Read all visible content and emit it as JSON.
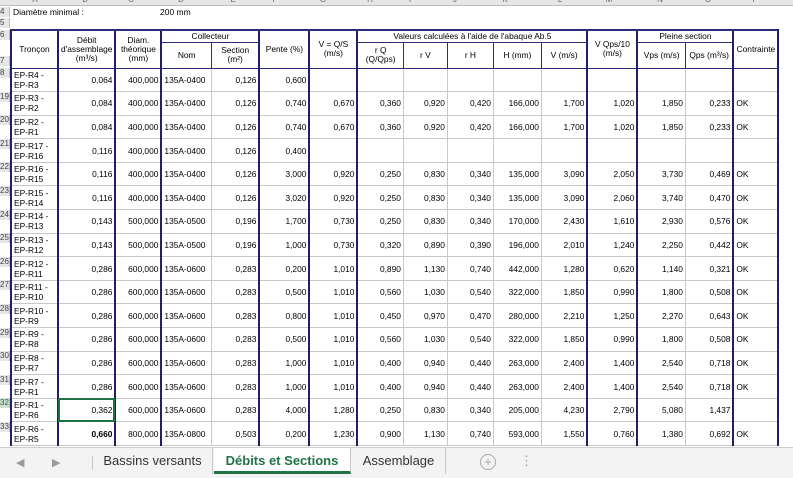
{
  "colhdr": [
    "A",
    "B",
    "C",
    "D",
    "E",
    "F",
    "G",
    "H",
    "I",
    "J",
    "K",
    "L",
    "M",
    "N",
    "O",
    "P"
  ],
  "top_rows": {
    "r4_label": "Diamètre minimal :",
    "r4_value": "200 mm",
    "rownums": [
      "4",
      "5",
      "6",
      "7"
    ]
  },
  "header": {
    "troncon": "Tronçon",
    "debit": "Débit d'assemblage (m³/s)",
    "diam": "Diam. théorique (mm)",
    "collecteur": "Collecteur",
    "nom": "Nom",
    "section": "Section (m²)",
    "pente": "Pente (%)",
    "vqs": "V = Q/S (m/s)",
    "valeurs": "Valeurs calculées à l'aide de l'abaque Ab.5",
    "rq": "r Q (Q/Qps)",
    "rv": "r V",
    "rh": "r H",
    "hmm": "H (mm)",
    "vms": "V (m/s)",
    "vqps": "V Qps/10 (m/s)",
    "pleine": "Pleine section",
    "vps": "Vps (m/s)",
    "qps": "Qps (m³/s)",
    "contrainte": "Contrainte"
  },
  "rows": [
    {
      "rn": "8",
      "t1": "EP-R4 -",
      "t2": "EP-R3",
      "q": "0,064",
      "d": "400,000",
      "nom": "135A-0400",
      "s": "0,126",
      "p": "0,600",
      "v": "",
      "rq": "",
      "rv": "",
      "rh": "",
      "h": "",
      "vv": "",
      "vq": "",
      "vps": "",
      "qps": "",
      "c": ""
    },
    {
      "rn": "19",
      "t1": "EP-R3 -",
      "t2": "EP-R2",
      "q": "0,084",
      "d": "400,000",
      "nom": "135A-0400",
      "s": "0,126",
      "p": "0,740",
      "v": "0,670",
      "rq": "0,360",
      "rv": "0,920",
      "rh": "0,420",
      "h": "166,000",
      "vv": "1,700",
      "vq": "1,020",
      "vps": "1,850",
      "qps": "0,233",
      "c": "OK"
    },
    {
      "rn": "20",
      "t1": "EP-R2 -",
      "t2": "EP-R1",
      "q": "0,084",
      "d": "400,000",
      "nom": "135A-0400",
      "s": "0,126",
      "p": "0,740",
      "v": "0,670",
      "rq": "0,360",
      "rv": "0,920",
      "rh": "0,420",
      "h": "166,000",
      "vv": "1,700",
      "vq": "1,020",
      "vps": "1,850",
      "qps": "0,233",
      "c": "OK"
    },
    {
      "rn": "21",
      "t1": "EP-R17 -",
      "t2": "EP-R16",
      "q": "0,116",
      "d": "400,000",
      "nom": "135A-0400",
      "s": "0,126",
      "p": "0,400",
      "v": "",
      "rq": "",
      "rv": "",
      "rh": "",
      "h": "",
      "vv": "",
      "vq": "",
      "vps": "",
      "qps": "",
      "c": ""
    },
    {
      "rn": "22",
      "t1": "EP-R16 -",
      "t2": "EP-R15",
      "q": "0,116",
      "d": "400,000",
      "nom": "135A-0400",
      "s": "0,126",
      "p": "3,000",
      "v": "0,920",
      "rq": "0,250",
      "rv": "0,830",
      "rh": "0,340",
      "h": "135,000",
      "vv": "3,090",
      "vq": "2,050",
      "vps": "3,730",
      "qps": "0,469",
      "c": "OK"
    },
    {
      "rn": "23",
      "t1": "EP-R15 -",
      "t2": "EP-R14",
      "q": "0,116",
      "d": "400,000",
      "nom": "135A-0400",
      "s": "0,126",
      "p": "3,020",
      "v": "0,920",
      "rq": "0,250",
      "rv": "0,830",
      "rh": "0,340",
      "h": "135,000",
      "vv": "3,090",
      "vq": "2,060",
      "vps": "3,740",
      "qps": "0,470",
      "c": "OK"
    },
    {
      "rn": "24",
      "t1": "EP-R14 -",
      "t2": "EP-R13",
      "q": "0,143",
      "d": "500,000",
      "nom": "135A-0500",
      "s": "0,196",
      "p": "1,700",
      "v": "0,730",
      "rq": "0,250",
      "rv": "0,830",
      "rh": "0,340",
      "h": "170,000",
      "vv": "2,430",
      "vq": "1,610",
      "vps": "2,930",
      "qps": "0,576",
      "c": "OK"
    },
    {
      "rn": "25",
      "t1": "EP-R13 -",
      "t2": "EP-R12",
      "q": "0,143",
      "d": "500,000",
      "nom": "135A-0500",
      "s": "0,196",
      "p": "1,000",
      "v": "0,730",
      "rq": "0,320",
      "rv": "0,890",
      "rh": "0,390",
      "h": "196,000",
      "vv": "2,010",
      "vq": "1,240",
      "vps": "2,250",
      "qps": "0,442",
      "c": "OK"
    },
    {
      "rn": "26",
      "t1": "EP-R12 -",
      "t2": "EP-R11",
      "q": "0,286",
      "d": "600,000",
      "nom": "135A-0600",
      "s": "0,283",
      "p": "0,200",
      "v": "1,010",
      "rq": "0,890",
      "rv": "1,130",
      "rh": "0,740",
      "h": "442,000",
      "vv": "1,280",
      "vq": "0,620",
      "vps": "1,140",
      "qps": "0,321",
      "c": "OK"
    },
    {
      "rn": "27",
      "t1": "EP-R11 -",
      "t2": "EP-R10",
      "q": "0,286",
      "d": "600,000",
      "nom": "135A-0600",
      "s": "0,283",
      "p": "0,500",
      "v": "1,010",
      "rq": "0,560",
      "rv": "1,030",
      "rh": "0,540",
      "h": "322,000",
      "vv": "1,850",
      "vq": "0,990",
      "vps": "1,800",
      "qps": "0,508",
      "c": "OK"
    },
    {
      "rn": "28",
      "t1": "EP-R10 -",
      "t2": "EP-R9",
      "q": "0,286",
      "d": "600,000",
      "nom": "135A-0600",
      "s": "0,283",
      "p": "0,800",
      "v": "1,010",
      "rq": "0,450",
      "rv": "0,970",
      "rh": "0,470",
      "h": "280,000",
      "vv": "2,210",
      "vq": "1,250",
      "vps": "2,270",
      "qps": "0,643",
      "c": "OK"
    },
    {
      "rn": "29",
      "t1": "EP-R9 -",
      "t2": "EP-R8",
      "q": "0,286",
      "d": "600,000",
      "nom": "135A-0600",
      "s": "0,283",
      "p": "0,500",
      "v": "1,010",
      "rq": "0,560",
      "rv": "1,030",
      "rh": "0,540",
      "h": "322,000",
      "vv": "1,850",
      "vq": "0,990",
      "vps": "1,800",
      "qps": "0,508",
      "c": "OK"
    },
    {
      "rn": "30",
      "t1": "EP-R8 -",
      "t2": "EP-R7",
      "q": "0,286",
      "d": "600,000",
      "nom": "135A-0600",
      "s": "0,283",
      "p": "1,000",
      "v": "1,010",
      "rq": "0,400",
      "rv": "0,940",
      "rh": "0,440",
      "h": "263,000",
      "vv": "2,400",
      "vq": "1,400",
      "vps": "2,540",
      "qps": "0,718",
      "c": "OK"
    },
    {
      "rn": "31",
      "t1": "EP-R7 -",
      "t2": "EP-R1",
      "q": "0,286",
      "d": "600,000",
      "nom": "135A-0600",
      "s": "0,283",
      "p": "1,000",
      "v": "1,010",
      "rq": "0,400",
      "rv": "0,940",
      "rh": "0,440",
      "h": "263,000",
      "vv": "2,400",
      "vq": "1,400",
      "vps": "2,540",
      "qps": "0,718",
      "c": "OK"
    },
    {
      "rn": "32",
      "t1": "EP-R1 -",
      "t2": "EP-R6",
      "q": "0,362",
      "d": "600,000",
      "nom": "135A-0600",
      "s": "0,283",
      "p": "4,000",
      "v": "1,280",
      "rq": "0,250",
      "rv": "0,830",
      "rh": "0,340",
      "h": "205,000",
      "vv": "4,230",
      "vq": "2,790",
      "vps": "5,080",
      "qps": "1,437",
      "c": ""
    },
    {
      "rn": "33",
      "t1": "EP-R6 -",
      "t2": "EP-R5",
      "q": "0,660",
      "d": "800,000",
      "nom": "135A-0800",
      "s": "0,503",
      "p": "0,200",
      "v": "1,230",
      "rq": "0,900",
      "rv": "1,130",
      "rh": "0,740",
      "h": "593,000",
      "vv": "1,550",
      "vq": "0,760",
      "vps": "1,380",
      "qps": "0,692",
      "c": "OK"
    }
  ],
  "tabs": {
    "t1": "Bassins versants",
    "t2": "Débits et Sections",
    "t3": "Assemblage",
    "add": "+",
    "prev": "◀",
    "next": "▶",
    "more": "⋮"
  }
}
